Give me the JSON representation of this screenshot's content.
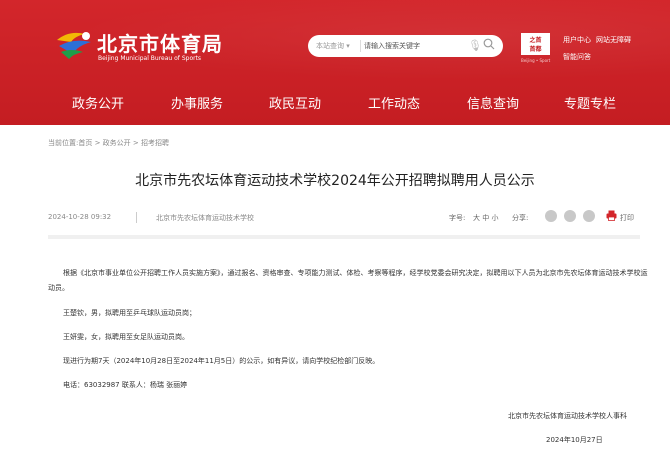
{
  "header": {
    "brand_cn": "北京市体育局",
    "brand_en": "Beijing Municipal Bureau of Sports",
    "search": {
      "scope": "本站查询",
      "placeholder": "请输入搜索关键字"
    },
    "badge": {
      "line1": "之首",
      "line2": "首都",
      "sub": "Beijing • Sport"
    },
    "util": {
      "user_center": "用户中心",
      "accessibility": "网站无障碍",
      "elder_mode": "智能问答"
    }
  },
  "nav": {
    "items": [
      "政务公开",
      "办事服务",
      "政民互动",
      "工作动态",
      "信息查询",
      "专题专栏"
    ]
  },
  "breadcrumb": "当前位置:首页 > 政务公开 > 招考招聘",
  "article": {
    "title": "北京市先农坛体育运动技术学校2024年公开招聘拟聘用人员公示",
    "date": "2024-10-28 09:32",
    "source": "北京市先农坛体育运动技术学校",
    "font_size_label": "字号:",
    "font_sizes": "大 中 小",
    "share_label": "分享:",
    "print_label": "打印",
    "paragraphs": [
      "根据《北京市事业单位公开招聘工作人员实施方案》，通过报名、资格审查、专项能力测试、体检、考察等程序，经学校党委会研究决定，拟聘用以下人员为北京市先农坛体育运动技术学校运动员。",
      "王楚钦，男，拟聘用至乒乓球队运动员岗；",
      "王妍雯，女，拟聘用至女足队运动员岗。",
      "现进行为期7天（2024年10月28日至2024年11月5日）的公示，如有异议，请向学校纪检部门反映。",
      "电话：63032987   联系人：杨瑞 张丽婷"
    ],
    "signature": "北京市先农坛体育运动技术学校人事科",
    "sign_date": "2024年10月27日"
  },
  "colors": {
    "header_red": "#c41d22",
    "print_red": "#d3262b"
  }
}
